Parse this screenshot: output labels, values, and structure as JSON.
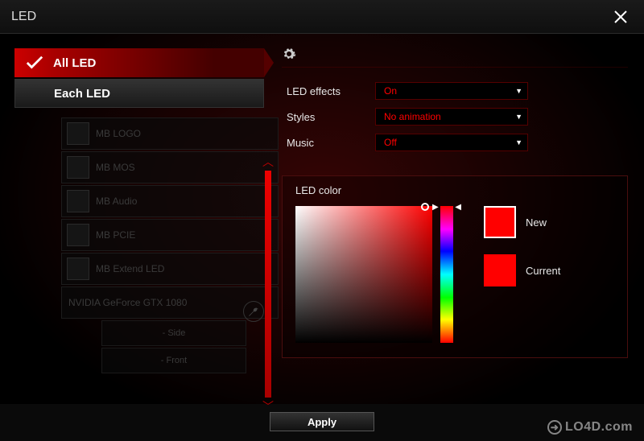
{
  "window": {
    "title": "LED"
  },
  "tabs": {
    "all": "All LED",
    "each": "Each LED"
  },
  "devices": {
    "items": [
      {
        "label": "MB LOGO"
      },
      {
        "label": "MB MOS"
      },
      {
        "label": "MB Audio"
      },
      {
        "label": "MB PCIE"
      },
      {
        "label": "MB Extend LED"
      },
      {
        "label": "NVIDIA GeForce GTX 1080"
      }
    ],
    "subs": [
      {
        "label": "- Side"
      },
      {
        "label": "- Front"
      }
    ]
  },
  "settings": {
    "led_effects": {
      "label": "LED effects",
      "value": "On"
    },
    "styles": {
      "label": "Styles",
      "value": "No animation"
    },
    "music": {
      "label": "Music",
      "value": "Off"
    }
  },
  "color_panel": {
    "title": "LED color",
    "new_label": "New",
    "current_label": "Current",
    "new_color": "#ff0000",
    "current_color": "#ff0000"
  },
  "footer": {
    "apply": "Apply"
  },
  "watermark": "LO4D.com"
}
